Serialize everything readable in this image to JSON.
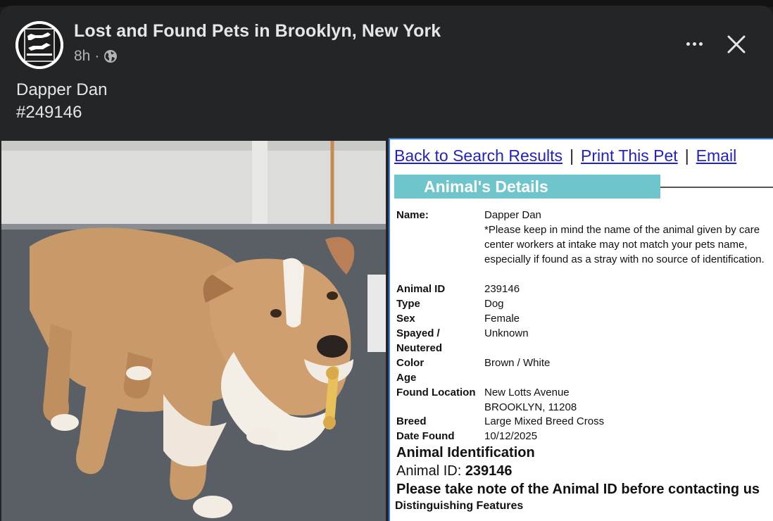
{
  "post": {
    "page_name": "Lost and Found Pets in Brooklyn, New York",
    "time": "8h",
    "separator": "·",
    "audience_icon": "globe-icon",
    "caption_line1": "Dapper Dan",
    "caption_line2": "#249146"
  },
  "details": {
    "nav": {
      "back": "Back to Search Results",
      "print": "Print This Pet",
      "email": "Email",
      "divider": "|"
    },
    "banner": "Animal's Details",
    "fields": {
      "name_label": "Name:",
      "name_value": "Dapper Dan",
      "name_note": "*Please keep in mind the name of the animal given by care center workers at intake may not match your pets name, especially if found as a stray with no source of identification.",
      "id_label": "Animal ID",
      "id_value": "239146",
      "type_label": "Type",
      "type_value": "Dog",
      "sex_label": "Sex",
      "sex_value": "Female",
      "spayed_label_1": "Spayed /",
      "spayed_label_2": "Neutered",
      "spayed_value": "Unknown",
      "color_label": "Color",
      "color_value": "Brown / White",
      "age_label": "Age",
      "location_label": "Found Location",
      "location_value_1": "New Lotts Avenue",
      "location_value_2": "BROOKLYN, 11208",
      "breed_label": "Breed",
      "breed_value": "Large Mixed Breed Cross",
      "date_label": "Date Found",
      "date_value": "10/12/2025"
    },
    "identification_heading": "Animal Identification",
    "id_line_label": "Animal ID:",
    "id_line_value": "239146",
    "note_line": "Please take note of the Animal ID before contacting us",
    "distinguishing": "Distinguishing Features"
  },
  "colors": {
    "card_bg": "#242526",
    "text_primary": "#e4e6eb",
    "text_secondary": "#b0b3b8",
    "banner": "#6ec5cc",
    "link": "#2121c8",
    "frame": "#3b7dd8"
  }
}
